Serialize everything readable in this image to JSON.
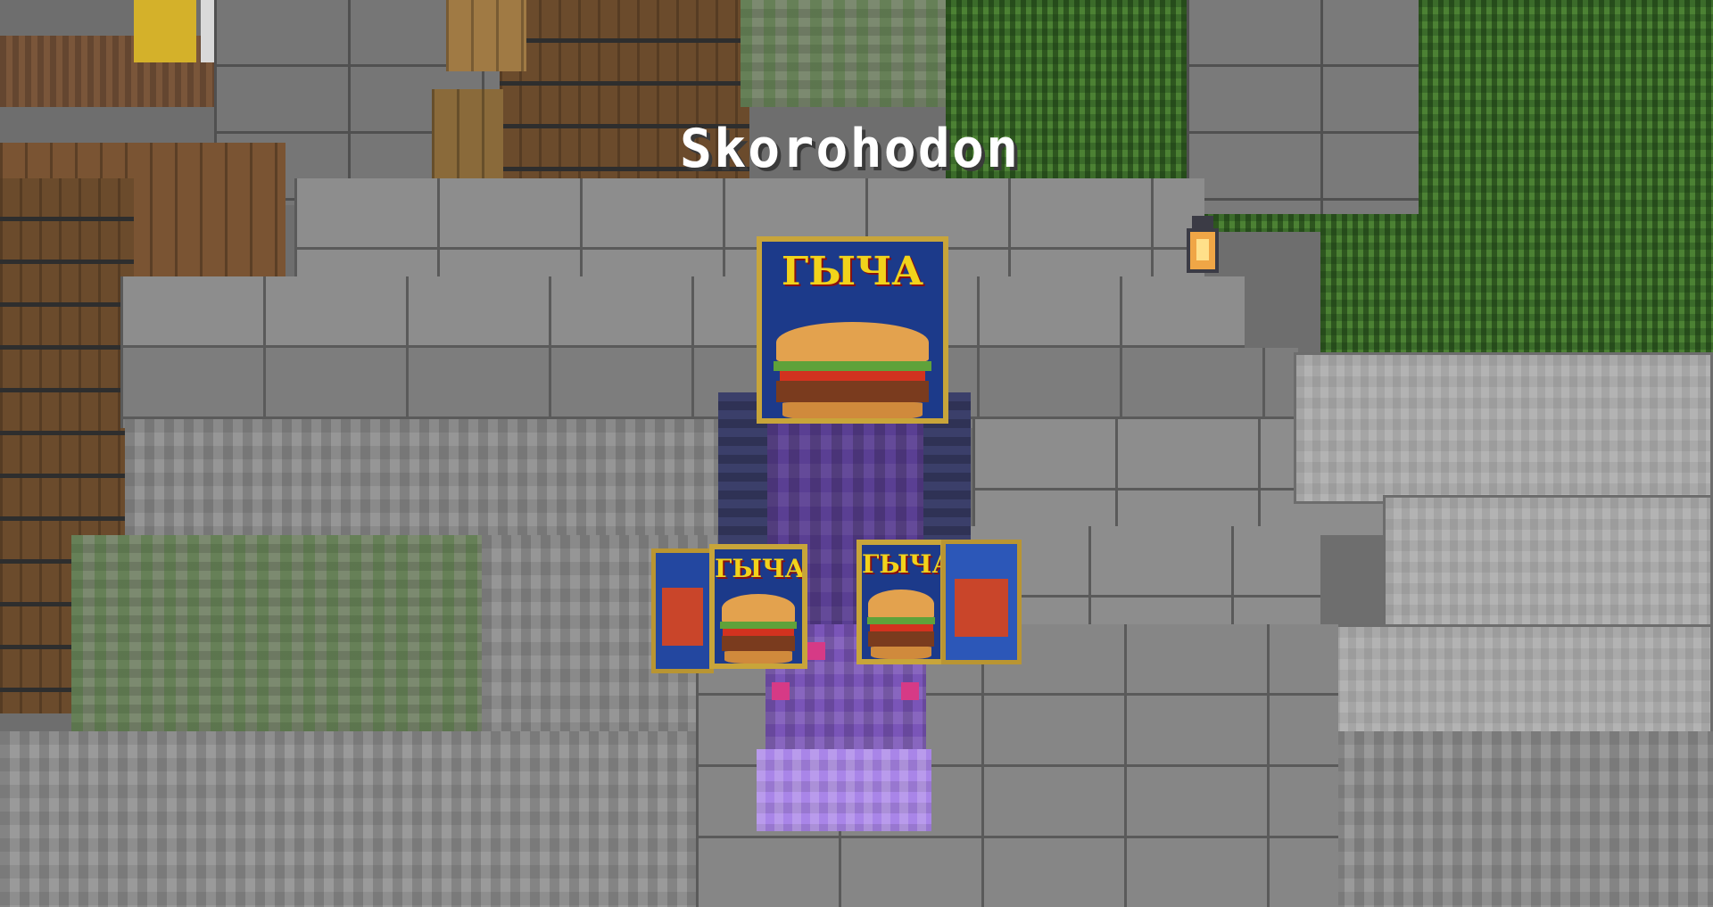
{
  "scene": {
    "player_name": "Skorohodon",
    "head_item_label": "ГЫЧА",
    "left_hand_item_label": "ГЫЧА",
    "right_hand_item_label": "ГЫЧА"
  },
  "icons": {
    "lantern": "lantern-icon",
    "can": "spam-can-icon"
  },
  "colors": {
    "nametag_text": "#ffffff",
    "can_label": "#f2d31b",
    "can_body": "#1c3a8a",
    "armor_purple": "#5a3f93"
  }
}
